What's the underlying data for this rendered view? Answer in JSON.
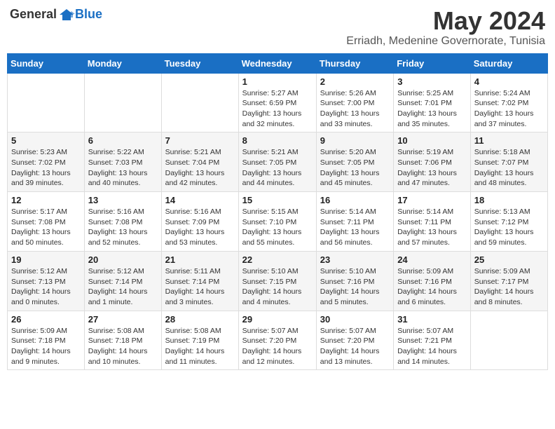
{
  "header": {
    "logo_general": "General",
    "logo_blue": "Blue",
    "month_year": "May 2024",
    "location": "Erriadh, Medenine Governorate, Tunisia"
  },
  "weekdays": [
    "Sunday",
    "Monday",
    "Tuesday",
    "Wednesday",
    "Thursday",
    "Friday",
    "Saturday"
  ],
  "weeks": [
    [
      {
        "day": "",
        "content": ""
      },
      {
        "day": "",
        "content": ""
      },
      {
        "day": "",
        "content": ""
      },
      {
        "day": "1",
        "content": "Sunrise: 5:27 AM\nSunset: 6:59 PM\nDaylight: 13 hours\nand 32 minutes."
      },
      {
        "day": "2",
        "content": "Sunrise: 5:26 AM\nSunset: 7:00 PM\nDaylight: 13 hours\nand 33 minutes."
      },
      {
        "day": "3",
        "content": "Sunrise: 5:25 AM\nSunset: 7:01 PM\nDaylight: 13 hours\nand 35 minutes."
      },
      {
        "day": "4",
        "content": "Sunrise: 5:24 AM\nSunset: 7:02 PM\nDaylight: 13 hours\nand 37 minutes."
      }
    ],
    [
      {
        "day": "5",
        "content": "Sunrise: 5:23 AM\nSunset: 7:02 PM\nDaylight: 13 hours\nand 39 minutes."
      },
      {
        "day": "6",
        "content": "Sunrise: 5:22 AM\nSunset: 7:03 PM\nDaylight: 13 hours\nand 40 minutes."
      },
      {
        "day": "7",
        "content": "Sunrise: 5:21 AM\nSunset: 7:04 PM\nDaylight: 13 hours\nand 42 minutes."
      },
      {
        "day": "8",
        "content": "Sunrise: 5:21 AM\nSunset: 7:05 PM\nDaylight: 13 hours\nand 44 minutes."
      },
      {
        "day": "9",
        "content": "Sunrise: 5:20 AM\nSunset: 7:05 PM\nDaylight: 13 hours\nand 45 minutes."
      },
      {
        "day": "10",
        "content": "Sunrise: 5:19 AM\nSunset: 7:06 PM\nDaylight: 13 hours\nand 47 minutes."
      },
      {
        "day": "11",
        "content": "Sunrise: 5:18 AM\nSunset: 7:07 PM\nDaylight: 13 hours\nand 48 minutes."
      }
    ],
    [
      {
        "day": "12",
        "content": "Sunrise: 5:17 AM\nSunset: 7:08 PM\nDaylight: 13 hours\nand 50 minutes."
      },
      {
        "day": "13",
        "content": "Sunrise: 5:16 AM\nSunset: 7:08 PM\nDaylight: 13 hours\nand 52 minutes."
      },
      {
        "day": "14",
        "content": "Sunrise: 5:16 AM\nSunset: 7:09 PM\nDaylight: 13 hours\nand 53 minutes."
      },
      {
        "day": "15",
        "content": "Sunrise: 5:15 AM\nSunset: 7:10 PM\nDaylight: 13 hours\nand 55 minutes."
      },
      {
        "day": "16",
        "content": "Sunrise: 5:14 AM\nSunset: 7:11 PM\nDaylight: 13 hours\nand 56 minutes."
      },
      {
        "day": "17",
        "content": "Sunrise: 5:14 AM\nSunset: 7:11 PM\nDaylight: 13 hours\nand 57 minutes."
      },
      {
        "day": "18",
        "content": "Sunrise: 5:13 AM\nSunset: 7:12 PM\nDaylight: 13 hours\nand 59 minutes."
      }
    ],
    [
      {
        "day": "19",
        "content": "Sunrise: 5:12 AM\nSunset: 7:13 PM\nDaylight: 14 hours\nand 0 minutes."
      },
      {
        "day": "20",
        "content": "Sunrise: 5:12 AM\nSunset: 7:14 PM\nDaylight: 14 hours\nand 1 minute."
      },
      {
        "day": "21",
        "content": "Sunrise: 5:11 AM\nSunset: 7:14 PM\nDaylight: 14 hours\nand 3 minutes."
      },
      {
        "day": "22",
        "content": "Sunrise: 5:10 AM\nSunset: 7:15 PM\nDaylight: 14 hours\nand 4 minutes."
      },
      {
        "day": "23",
        "content": "Sunrise: 5:10 AM\nSunset: 7:16 PM\nDaylight: 14 hours\nand 5 minutes."
      },
      {
        "day": "24",
        "content": "Sunrise: 5:09 AM\nSunset: 7:16 PM\nDaylight: 14 hours\nand 6 minutes."
      },
      {
        "day": "25",
        "content": "Sunrise: 5:09 AM\nSunset: 7:17 PM\nDaylight: 14 hours\nand 8 minutes."
      }
    ],
    [
      {
        "day": "26",
        "content": "Sunrise: 5:09 AM\nSunset: 7:18 PM\nDaylight: 14 hours\nand 9 minutes."
      },
      {
        "day": "27",
        "content": "Sunrise: 5:08 AM\nSunset: 7:18 PM\nDaylight: 14 hours\nand 10 minutes."
      },
      {
        "day": "28",
        "content": "Sunrise: 5:08 AM\nSunset: 7:19 PM\nDaylight: 14 hours\nand 11 minutes."
      },
      {
        "day": "29",
        "content": "Sunrise: 5:07 AM\nSunset: 7:20 PM\nDaylight: 14 hours\nand 12 minutes."
      },
      {
        "day": "30",
        "content": "Sunrise: 5:07 AM\nSunset: 7:20 PM\nDaylight: 14 hours\nand 13 minutes."
      },
      {
        "day": "31",
        "content": "Sunrise: 5:07 AM\nSunset: 7:21 PM\nDaylight: 14 hours\nand 14 minutes."
      },
      {
        "day": "",
        "content": ""
      }
    ]
  ]
}
